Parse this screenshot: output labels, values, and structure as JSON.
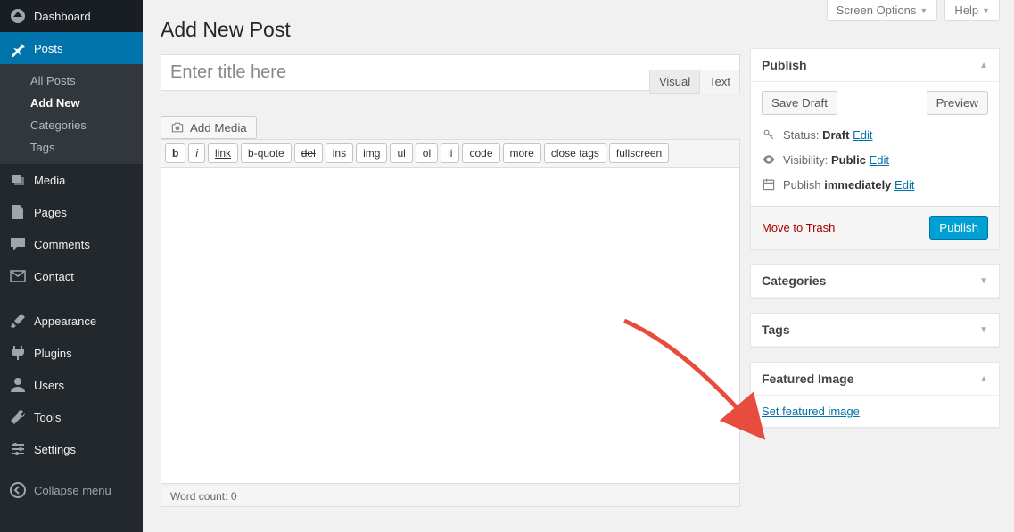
{
  "screen_meta": {
    "options": "Screen Options",
    "help": "Help"
  },
  "menu": {
    "dashboard": "Dashboard",
    "posts": "Posts",
    "posts_sub": [
      "All Posts",
      "Add New",
      "Categories",
      "Tags"
    ],
    "media": "Media",
    "pages": "Pages",
    "comments": "Comments",
    "contact": "Contact",
    "appearance": "Appearance",
    "plugins": "Plugins",
    "users": "Users",
    "tools": "Tools",
    "settings": "Settings",
    "collapse": "Collapse menu"
  },
  "page": {
    "title": "Add New Post"
  },
  "editor": {
    "title_placeholder": "Enter title here",
    "add_media": "Add Media",
    "tabs": {
      "visual": "Visual",
      "text": "Text"
    },
    "quicktags": [
      "b",
      "i",
      "link",
      "b-quote",
      "del",
      "ins",
      "img",
      "ul",
      "ol",
      "li",
      "code",
      "more",
      "close tags",
      "fullscreen"
    ],
    "wordcount_label": "Word count:",
    "wordcount": "0"
  },
  "publish": {
    "heading": "Publish",
    "save_draft": "Save Draft",
    "preview": "Preview",
    "status_label": "Status:",
    "status_value": "Draft",
    "visibility_label": "Visibility:",
    "visibility_value": "Public",
    "publish_label": "Publish",
    "publish_value": "immediately",
    "edit": "Edit",
    "trash": "Move to Trash",
    "submit": "Publish"
  },
  "categories": {
    "heading": "Categories"
  },
  "tags": {
    "heading": "Tags"
  },
  "featured": {
    "heading": "Featured Image",
    "link": "Set featured image"
  }
}
